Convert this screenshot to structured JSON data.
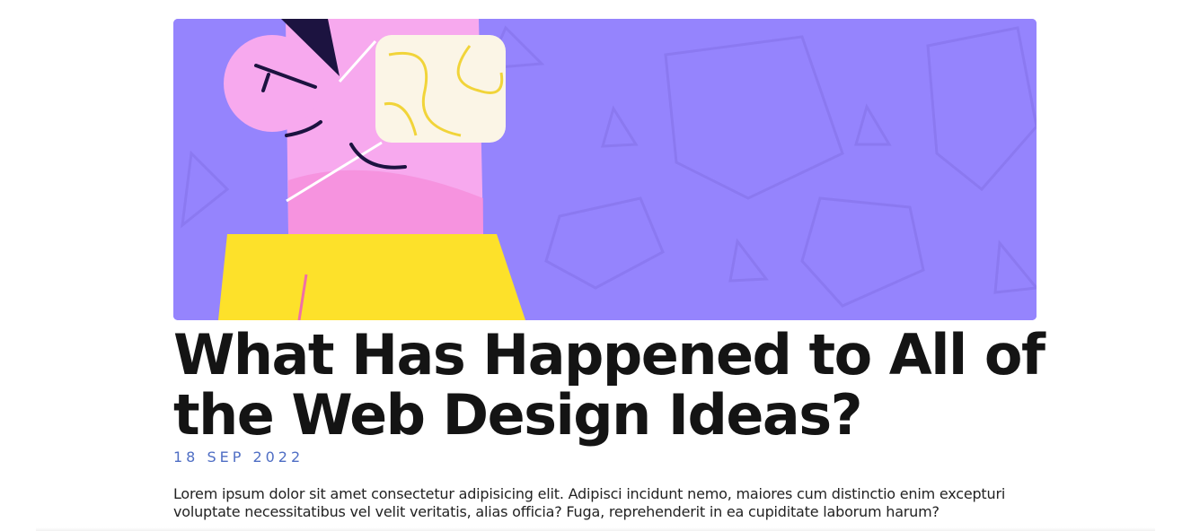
{
  "article": {
    "hero_image": "illustration-person-with-face-mask",
    "hero_background": "#9584fd",
    "title": "What Has Happened to All of the Web Design Ideas?",
    "date": "18 SEP 2022",
    "excerpt": "Lorem ipsum dolor sit amet consectetur adipisicing elit. Adipisci incidunt nemo, maiores cum distinctio enim excepturi voluptate necessitatibus vel velit veritatis, alias officia? Fuga, reprehenderit in ea cupiditate laborum harum?"
  },
  "colors": {
    "title": "#141414",
    "date": "#4f6ec4",
    "text": "#222222"
  }
}
